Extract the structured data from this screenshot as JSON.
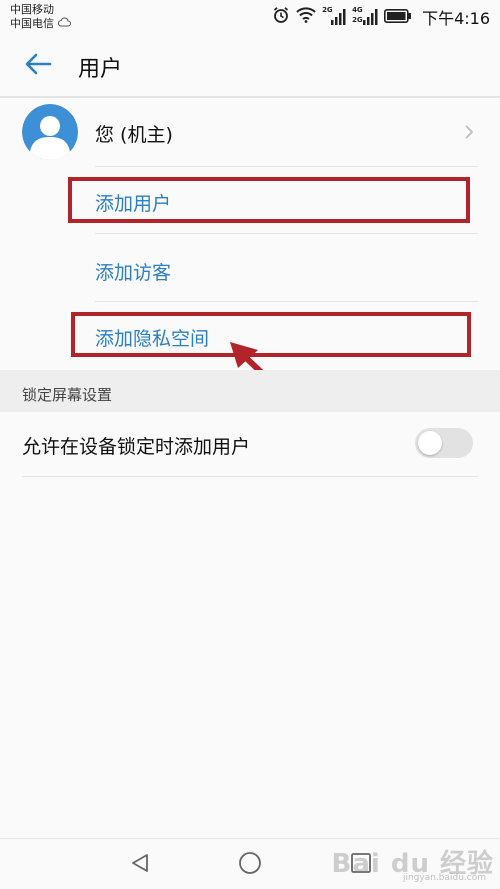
{
  "status_bar": {
    "carrier_1": "中国移动",
    "carrier_2": "中国电信",
    "signal_label_1": "2G",
    "signal_label_2": "4G",
    "signal_label_3": "2G",
    "time": "下午4:16",
    "icons": [
      "cloud-icon",
      "alarm-icon",
      "wifi-icon",
      "signal-icon",
      "signal-icon",
      "battery-icon"
    ]
  },
  "app_bar": {
    "title": "用户",
    "back_icon": "arrow-left-icon"
  },
  "user": {
    "name": "您 (机主)"
  },
  "actions": [
    {
      "label": "添加用户"
    },
    {
      "label": "添加访客"
    },
    {
      "label": "添加隐私空间"
    }
  ],
  "lock_screen": {
    "section_title": "锁定屏幕设置",
    "toggle_label": "允许在设备锁定时添加用户",
    "toggle_on": false
  },
  "watermark": {
    "text": "Bai du 经验",
    "sub": "jingyan.baidu.com"
  },
  "colors": {
    "accent": "#2a7fc5",
    "annotation": "#b3242a",
    "avatar": "#3d8fd6"
  }
}
